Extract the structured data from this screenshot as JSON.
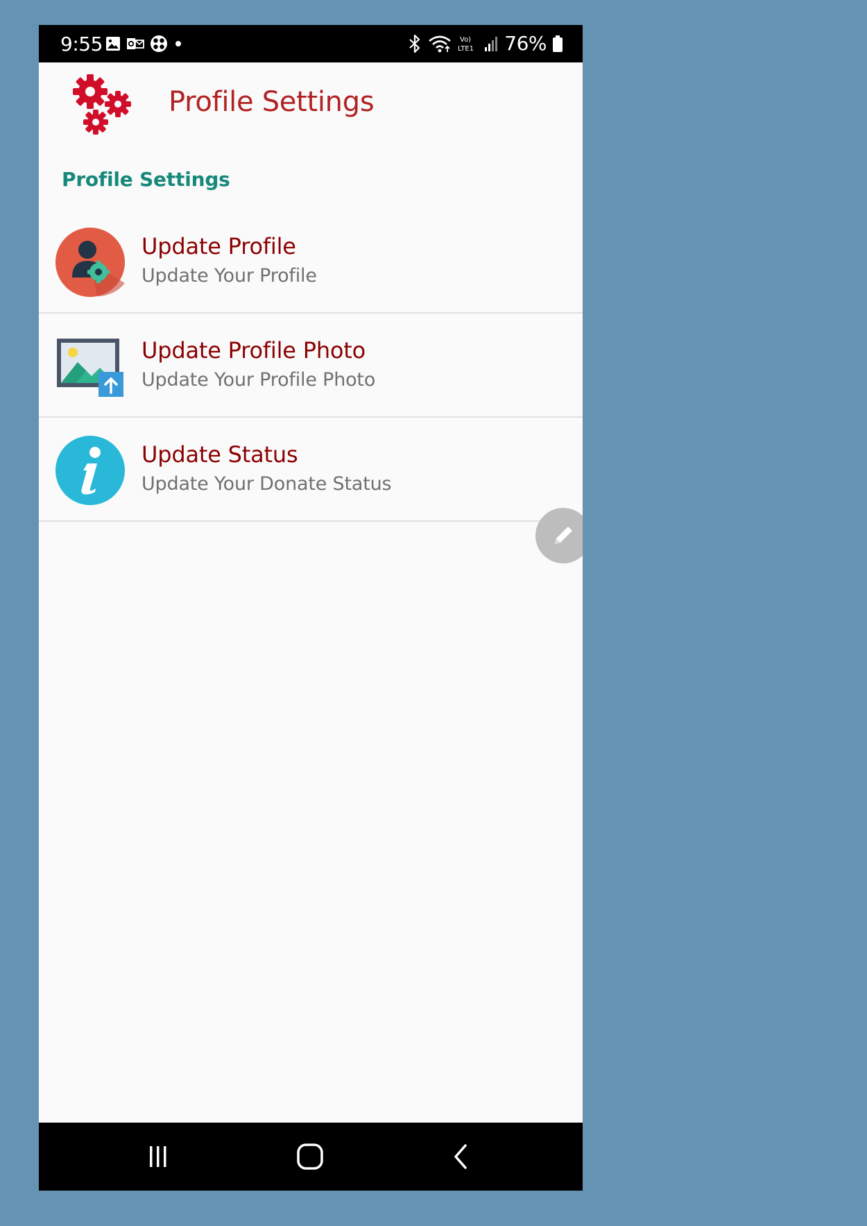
{
  "status_bar": {
    "time": "9:55",
    "battery": "76%",
    "left_icons": [
      "gallery-icon",
      "outlook-icon",
      "game-icon",
      "dot-icon"
    ],
    "right_icons": [
      "bluetooth-icon",
      "wifi-icon",
      "volte-icon",
      "signal-icon",
      "battery-icon"
    ]
  },
  "header": {
    "title": "Profile Settings",
    "logo_icon": "gears-icon",
    "accent_color": "#b22222"
  },
  "section": {
    "title": "Profile Settings",
    "color": "#16897a"
  },
  "items": [
    {
      "title": "Update Profile",
      "subtitle": "Update Your Profile",
      "icon": "user-settings-icon"
    },
    {
      "title": "Update Profile Photo",
      "subtitle": "Update Your Profile Photo",
      "icon": "image-upload-icon"
    },
    {
      "title": "Update Status",
      "subtitle": "Update Your Donate Status",
      "icon": "info-icon"
    }
  ],
  "fab": {
    "icon": "pencil-icon"
  },
  "nav_bar": {
    "buttons": [
      "recent-apps-icon",
      "home-icon",
      "back-icon"
    ]
  }
}
